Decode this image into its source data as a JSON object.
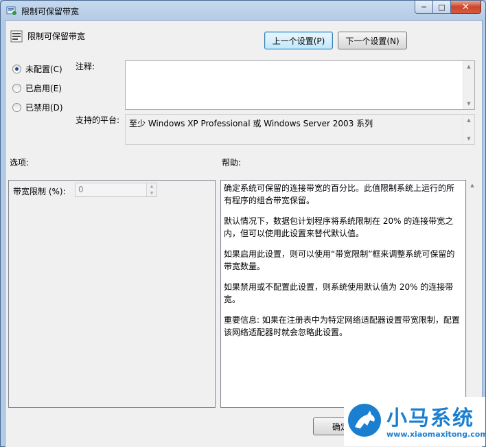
{
  "window": {
    "title": "限制可保留带宽",
    "min_glyph": "─",
    "max_glyph": "□",
    "close_glyph": "✕"
  },
  "header": {
    "setting_name": "限制可保留带宽",
    "prev_button": "上一个设置(P)",
    "next_button": "下一个设置(N)"
  },
  "state": {
    "options": [
      {
        "label": "未配置(C)",
        "checked": true
      },
      {
        "label": "已启用(E)",
        "checked": false
      },
      {
        "label": "已禁用(D)",
        "checked": false
      }
    ]
  },
  "comment": {
    "label": "注释:",
    "value": ""
  },
  "platform": {
    "label": "支持的平台:",
    "value": "至少 Windows XP Professional 或 Windows Server 2003 系列"
  },
  "options_section": {
    "title": "选项:",
    "bandwidth_label": "带宽限制 (%):",
    "bandwidth_value": "0"
  },
  "help_section": {
    "title": "帮助:",
    "paragraphs": [
      "确定系统可保留的连接带宽的百分比。此值限制系统上运行的所有程序的组合带宽保留。",
      "默认情况下，数据包计划程序将系统限制在 20% 的连接带宽之内，但可以使用此设置来替代默认值。",
      "如果启用此设置，则可以使用“带宽限制”框来调整系统可保留的带宽数量。",
      "如果禁用或不配置此设置，则系统使用默认值为 20% 的连接带宽。",
      "重要信息: 如果在注册表中为特定网络适配器设置带宽限制，配置该网络适配器时就会忽略此设置。"
    ]
  },
  "footer": {
    "ok_button": "确定"
  },
  "watermark": {
    "title": "小马系统",
    "url": "www.xiaomaxitong.com"
  },
  "colors": {
    "accent": "#1b7fd1",
    "close_red": "#c9462c"
  }
}
